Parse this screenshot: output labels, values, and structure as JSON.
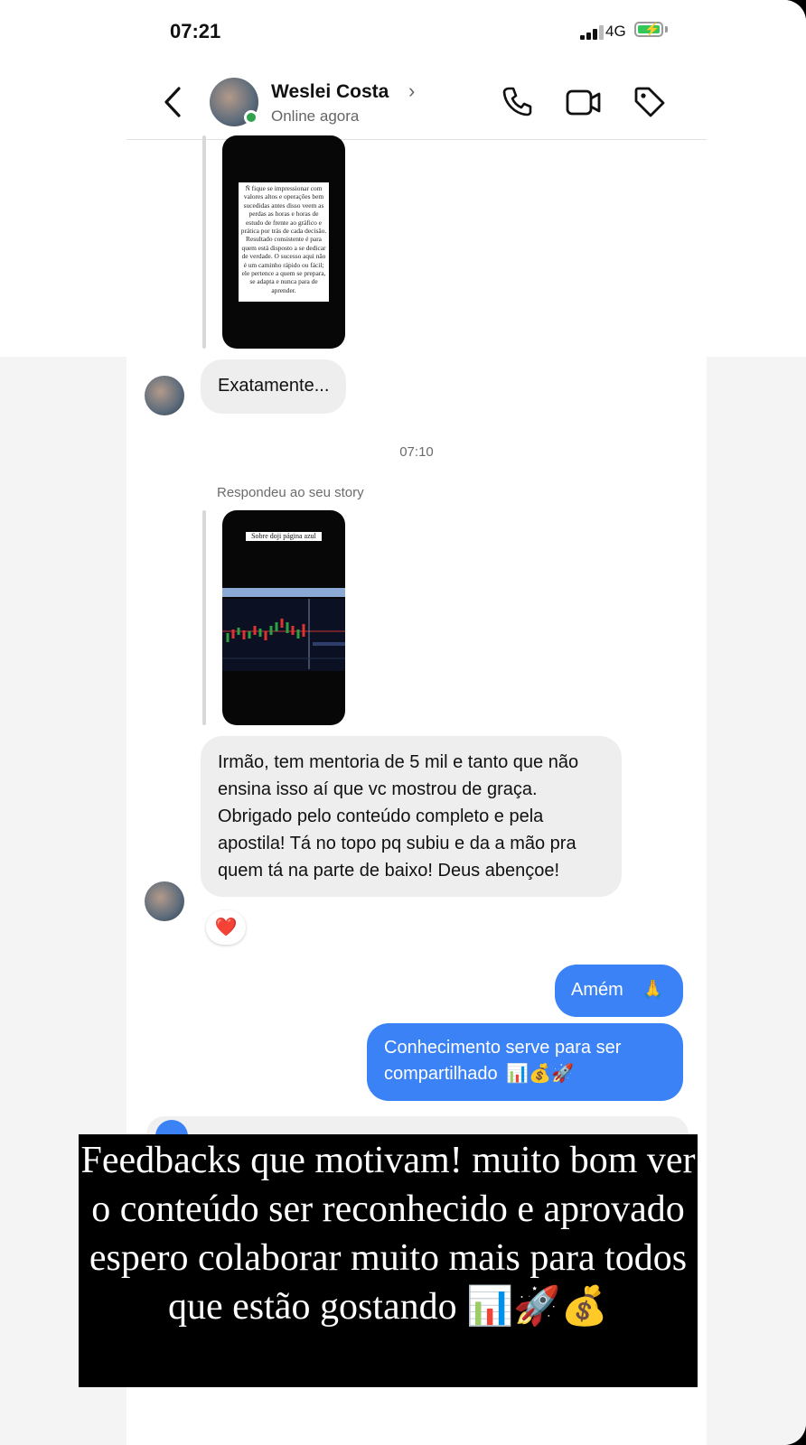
{
  "status_bar": {
    "time": "07:21",
    "network": "4G",
    "battery_color": "#34c759"
  },
  "header": {
    "back_icon": "chevron-left-icon",
    "contact_name": "Weslei Costa",
    "name_chevron": "›",
    "contact_status": "Online agora",
    "actions": [
      "phone-icon",
      "video-icon",
      "tag-icon"
    ]
  },
  "conversation": {
    "story1_text": "Ñ fique se impressionar com valores altos e operações bem sucedidas antes disso veem as perdas as horas e horas de estudo de frente ao gráfico e prática por trás de cada decisão. Resultado consistente é para quem está disposto a se dedicar de verdade. O sucesso aqui não é um caminho rápido ou fácil; ele pertence a quem se prepara, se adapta e nunca para de aprender.",
    "msg1": "Exatamente...",
    "timestamp": "07:10",
    "reply_label": "Respondeu ao seu story",
    "story2_caption": "Sobre doji página azul",
    "msg2": "Irmão, tem mentoria de 5 mil e tanto que não ensina isso aí que vc mostrou de graça. Obrigado pelo conteúdo completo e pela apostila! Tá no topo pq subiu e da a mão pra quem tá na parte de baixo! Deus abençoe!",
    "reaction": "❤️",
    "msg3_text": "Amém",
    "msg3_emoji": "🙏",
    "msg4_text": "Conhecimento serve para ser compartilhado",
    "msg4_emojis": "📊💰🚀"
  },
  "overlay": {
    "caption": "Feedbacks que motivam! muito bom ver o conteúdo ser reconhecido e aprovado espero colaborar muito mais para todos que estão gostando 📊🚀💰"
  },
  "colors": {
    "outgoing_bubble": "#3b82f6",
    "incoming_bubble": "#eeeeef",
    "online": "#31a24c"
  }
}
